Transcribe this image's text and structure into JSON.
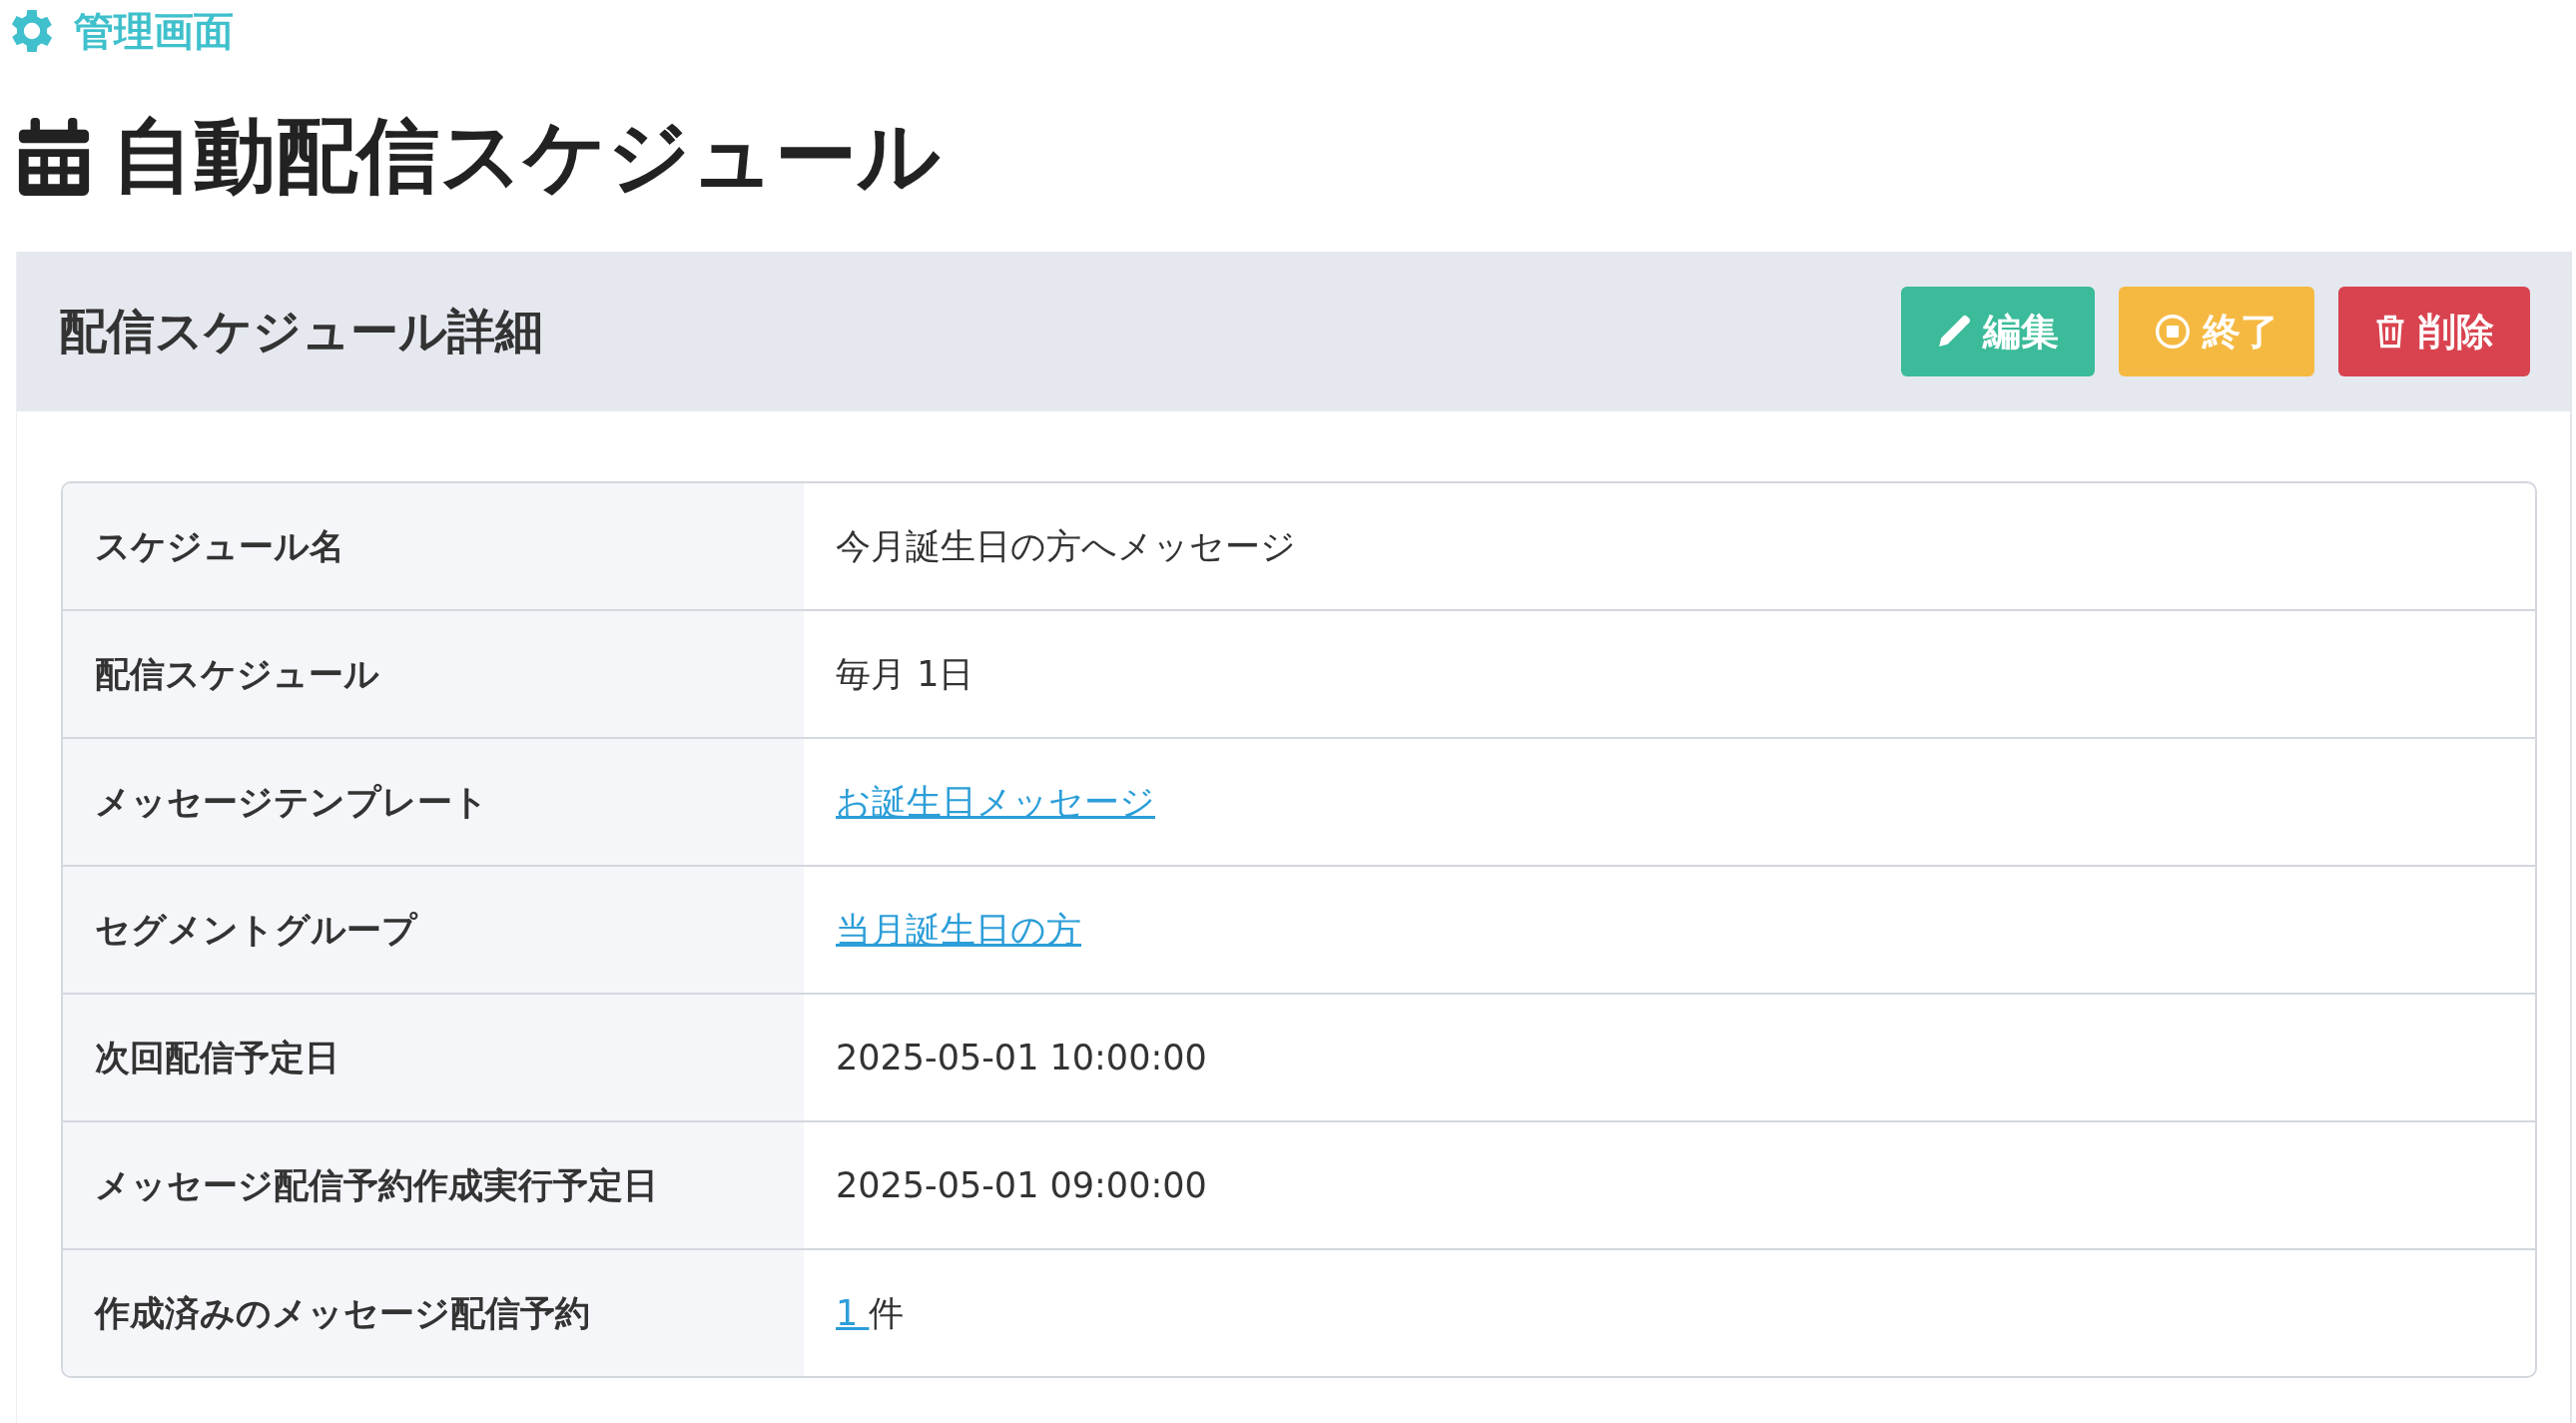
{
  "brand": {
    "label": "管理画面"
  },
  "page_title": "自動配信スケジュール",
  "card": {
    "title": "配信スケジュール詳細",
    "buttons": [
      {
        "label": "編集",
        "kind": "edit"
      },
      {
        "label": "終了",
        "kind": "stop"
      },
      {
        "label": "削除",
        "kind": "delete"
      }
    ],
    "rows": [
      {
        "label": "スケジュール名",
        "kind": "text",
        "value": "今月誕生日の方へメッセージ"
      },
      {
        "label": "配信スケジュール",
        "kind": "text",
        "value": "毎月 1日"
      },
      {
        "label": "メッセージテンプレート",
        "kind": "link",
        "value": "お誕生日メッセージ"
      },
      {
        "label": "セグメントグループ",
        "kind": "link",
        "value": "当月誕生日の方"
      },
      {
        "label": "次回配信予定日",
        "kind": "text",
        "value": "2025-05-01 10:00:00"
      },
      {
        "label": "メッセージ配信予約作成実行予定日",
        "kind": "text",
        "value": "2025-05-01 09:00:00"
      },
      {
        "label": "作成済みのメッセージ配信予約",
        "kind": "count",
        "value": "1 ",
        "suffix": "件"
      }
    ]
  }
}
